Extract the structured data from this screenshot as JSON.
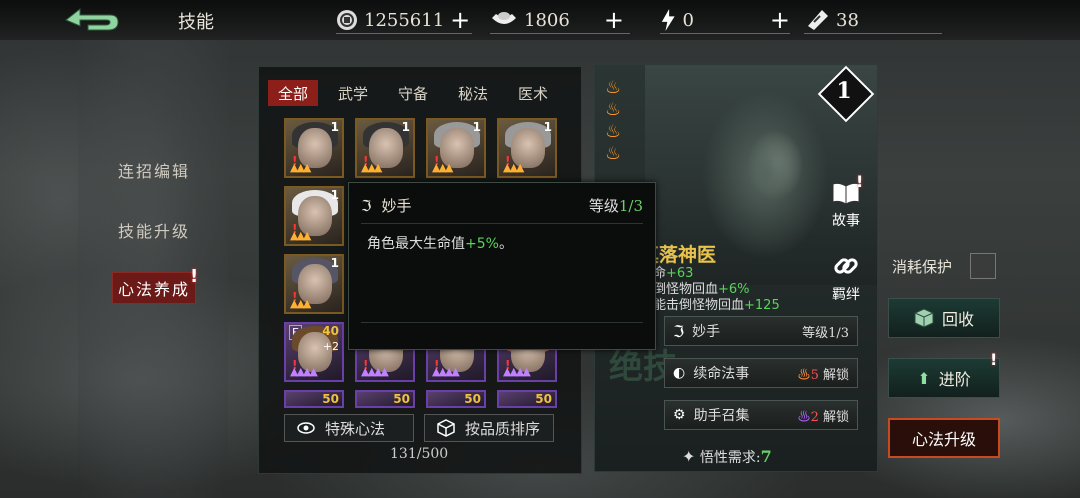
{
  "header": {
    "title": "技能"
  },
  "resources": [
    {
      "icon": "coin-icon",
      "value": "1255611"
    },
    {
      "icon": "ingot-icon",
      "value": "1806"
    },
    {
      "icon": "lightning-icon",
      "value": "0"
    },
    {
      "icon": "ticket-icon",
      "value": "38"
    }
  ],
  "sidebar": {
    "items": [
      {
        "label": "连招编辑"
      },
      {
        "label": "技能升级"
      },
      {
        "label": "心法养成"
      }
    ],
    "alert": "!"
  },
  "tabs": [
    "全部",
    "武学",
    "守备",
    "秘法",
    "医术"
  ],
  "cards": [
    {
      "level": "1",
      "quality": "gold"
    },
    {
      "level": "1",
      "quality": "gold"
    },
    {
      "level": "1",
      "quality": "gold"
    },
    {
      "level": "1",
      "quality": "gold"
    },
    {
      "level": "1",
      "quality": "gold"
    },
    {
      "level": "1",
      "quality": "gold"
    },
    {
      "level": "40",
      "badge": "E",
      "plus": "+2",
      "quality": "purple"
    },
    {
      "level": "",
      "quality": "purple"
    },
    {
      "level": "",
      "quality": "purple"
    },
    {
      "level": "",
      "quality": "purple"
    },
    {
      "level": "50",
      "quality": "purple"
    },
    {
      "level": "50",
      "quality": "purple"
    },
    {
      "level": "50",
      "quality": "purple"
    },
    {
      "level": "50",
      "quality": "purple"
    }
  ],
  "grid_buttons": {
    "special": "特殊心法",
    "sort": "按品质排序"
  },
  "count": "131/500",
  "tooltip": {
    "name": "妙手",
    "level_label": "等级",
    "level_value": "1/3",
    "desc_prefix": "角色最大生命值",
    "desc_value": "+5%",
    "desc_suffix": "。"
  },
  "hero": {
    "rank": "1",
    "name": "真落神医",
    "story": "故事",
    "bond": "羁绊",
    "stats": [
      {
        "prefix": "生命",
        "value": "+63"
      },
      {
        "prefix": "击倒怪物回血",
        "value": "+6%"
      },
      {
        "prefix": "技能击倒怪物回血",
        "value": "+125"
      }
    ],
    "vertical_text": "绝技",
    "skills": [
      {
        "name": "妙手",
        "right": "等级1/3"
      },
      {
        "name": "续命法事",
        "cost": "5",
        "right": "解锁"
      },
      {
        "name": "助手召集",
        "cost": "2",
        "right": "解锁"
      }
    ],
    "requirement_label": "悟性需求:",
    "requirement_value": "7"
  },
  "right": {
    "protect": "消耗保护",
    "recycle": "回收",
    "advance": "进阶",
    "upgrade": "心法升级"
  }
}
